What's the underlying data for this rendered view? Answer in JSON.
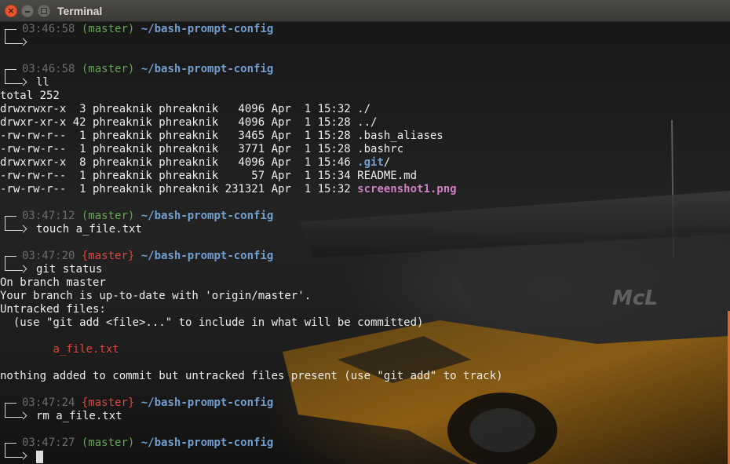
{
  "window": {
    "title": "Terminal"
  },
  "prompts": [
    {
      "time": "03:46:58",
      "branch": "(master)",
      "path": "~/bash-prompt-config",
      "command": ""
    },
    {
      "time": "03:46:58",
      "branch": "(master)",
      "path": "~/bash-prompt-config",
      "command": "ll"
    },
    {
      "time": "03:47:12",
      "branch": "(master)",
      "path": "~/bash-prompt-config",
      "command": "touch a_file.txt"
    },
    {
      "time": "03:47:20",
      "branch": "{master}",
      "path": "~/bash-prompt-config",
      "command": "git status"
    },
    {
      "time": "03:47:24",
      "branch": "{master}",
      "path": "~/bash-prompt-config",
      "command": "rm a_file.txt"
    },
    {
      "time": "03:47:27",
      "branch": "(master)",
      "path": "~/bash-prompt-config",
      "command": ""
    }
  ],
  "ll_output": {
    "total": "total 252",
    "rows": [
      {
        "meta": "drwxrwxr-x  3 phreaknik phreaknik   4096 Apr  1 15:32 ",
        "name": "./"
      },
      {
        "meta": "drwxr-xr-x 42 phreaknik phreaknik   4096 Apr  1 15:28 ",
        "name": "../"
      },
      {
        "meta": "-rw-rw-r--  1 phreaknik phreaknik   3465 Apr  1 15:28 ",
        "name": ".bash_aliases"
      },
      {
        "meta": "-rw-rw-r--  1 phreaknik phreaknik   3771 Apr  1 15:28 ",
        "name": ".bashrc"
      },
      {
        "meta": "drwxrwxr-x  8 phreaknik phreaknik   4096 Apr  1 15:46 ",
        "name": ".git",
        "suffix": "/"
      },
      {
        "meta": "-rw-rw-r--  1 phreaknik phreaknik     57 Apr  1 15:34 ",
        "name": "README.md"
      },
      {
        "meta": "-rw-rw-r--  1 phreaknik phreaknik 231321 Apr  1 15:32 ",
        "name": "screenshot1.png"
      }
    ]
  },
  "git_status_output": {
    "line1": "On branch master",
    "line2": "Your branch is up-to-date with 'origin/master'.",
    "line3": "Untracked files:",
    "line4": "  (use \"git add <file>...\" to include in what will be committed)",
    "untracked_file": "a_file.txt",
    "line5": "nothing added to commit but untracked files present (use \"git add\" to track)"
  },
  "colors": {
    "time": "#6c6c6c",
    "branch_clean": "#5fa84a",
    "branch_dirty": "#e0443a",
    "path": "#729fcf",
    "image_file": "#d07ec6",
    "untracked": "#e0443a",
    "scrollbar": "#e0662a"
  }
}
